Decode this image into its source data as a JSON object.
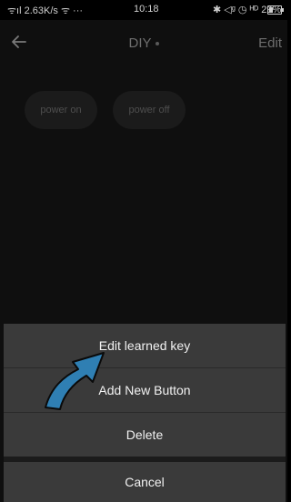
{
  "status_bar": {
    "left": "ᯤıl 2.63K/s ᯤ ···",
    "time": "10:18",
    "right": "✱ ◁ᵍ ◷ ᴴᴰ 29%"
  },
  "header": {
    "title": "DIY",
    "edit_label": "Edit"
  },
  "buttons": {
    "power_on": "power on",
    "power_off": "power off"
  },
  "action_sheet": {
    "edit_learned_key": "Edit learned key",
    "add_new_button": "Add New Button",
    "delete": "Delete",
    "cancel": "Cancel"
  },
  "colors": {
    "background": "#0f0f0f",
    "sheet": "#3a3a3a",
    "arrow": "#2f7fb3"
  },
  "icons": [
    "back-arrow-icon",
    "battery-icon",
    "pointer-arrow-annotation"
  ]
}
